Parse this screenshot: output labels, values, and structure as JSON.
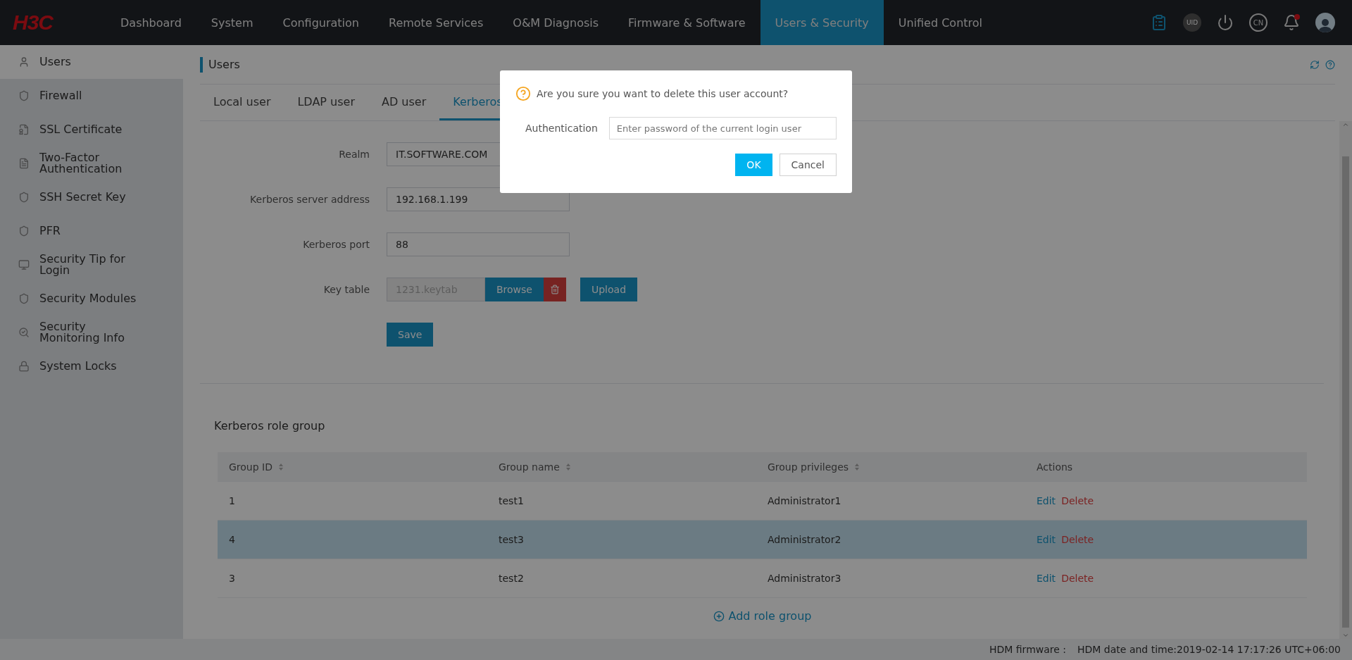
{
  "topbar": {
    "logo": "H3C",
    "nav": [
      {
        "label": "Dashboard",
        "selected": false
      },
      {
        "label": "System",
        "selected": false
      },
      {
        "label": "Configuration",
        "selected": false
      },
      {
        "label": "Remote Services",
        "selected": false
      },
      {
        "label": "O&M Diagnosis",
        "selected": false
      },
      {
        "label": "Firmware & Software",
        "selected": false
      },
      {
        "label": "Users & Security",
        "selected": true
      },
      {
        "label": "Unified Control",
        "selected": false
      }
    ],
    "uid_label": "UID",
    "language": "CN",
    "alert": true
  },
  "sidebar": {
    "items": [
      {
        "label": "Users",
        "selected": true
      },
      {
        "label": "Firewall",
        "selected": false
      },
      {
        "label": "SSL Certificate",
        "selected": false
      },
      {
        "label": "Two-Factor Authentication",
        "selected": false
      },
      {
        "label": "SSH Secret Key",
        "selected": false
      },
      {
        "label": "PFR",
        "selected": false
      },
      {
        "label": "Security Tip for Login",
        "selected": false
      },
      {
        "label": "Security Modules",
        "selected": false
      },
      {
        "label": "Security Monitoring Info",
        "selected": false
      },
      {
        "label": "System Locks",
        "selected": false
      }
    ]
  },
  "page": {
    "title": "Users",
    "tabs": [
      {
        "label": "Local user",
        "selected": false
      },
      {
        "label": "LDAP user",
        "selected": false
      },
      {
        "label": "AD user",
        "selected": false
      },
      {
        "label": "Kerberos",
        "selected": true
      }
    ],
    "form": {
      "fields": [
        {
          "label": "Realm",
          "value": "IT.SOFTWARE.COM",
          "kind": "text"
        },
        {
          "label": "Kerberos server address",
          "value": "192.168.1.199",
          "kind": "text"
        },
        {
          "label": "Kerberos port",
          "value": "88",
          "kind": "text"
        },
        {
          "label": "Key table",
          "value": "1231.keytab",
          "kind": "file",
          "disabled": true,
          "browse": "Browse",
          "upload": "Upload"
        }
      ],
      "save": "Save"
    },
    "role_group": {
      "title": "Kerberos role group",
      "columns": [
        {
          "label": "Group ID",
          "sortable": true
        },
        {
          "label": "Group name",
          "sortable": true
        },
        {
          "label": "Group privileges",
          "sortable": true
        },
        {
          "label": "Actions",
          "sortable": false
        }
      ],
      "rows": [
        {
          "cells": [
            "1",
            "test1",
            "Administrator1"
          ],
          "edit": "Edit",
          "delete": "Delete",
          "highlighted": false
        },
        {
          "cells": [
            "4",
            "test3",
            "Administrator2"
          ],
          "edit": "Edit",
          "delete": "Delete",
          "highlighted": true
        },
        {
          "cells": [
            "3",
            "test2",
            "Administrator3"
          ],
          "edit": "Edit",
          "delete": "Delete",
          "highlighted": false
        }
      ],
      "add": "Add role group"
    }
  },
  "status_bar": {
    "firmware": "HDM firmware :",
    "datetime": "HDM date and time:2019-02-14 17:17:26 UTC+06:00"
  },
  "dialog": {
    "message": "Are you sure you want to delete this user account?",
    "field_label": "Authentication",
    "placeholder": "Enter password of the current login user",
    "ok": "OK",
    "cancel": "Cancel"
  }
}
